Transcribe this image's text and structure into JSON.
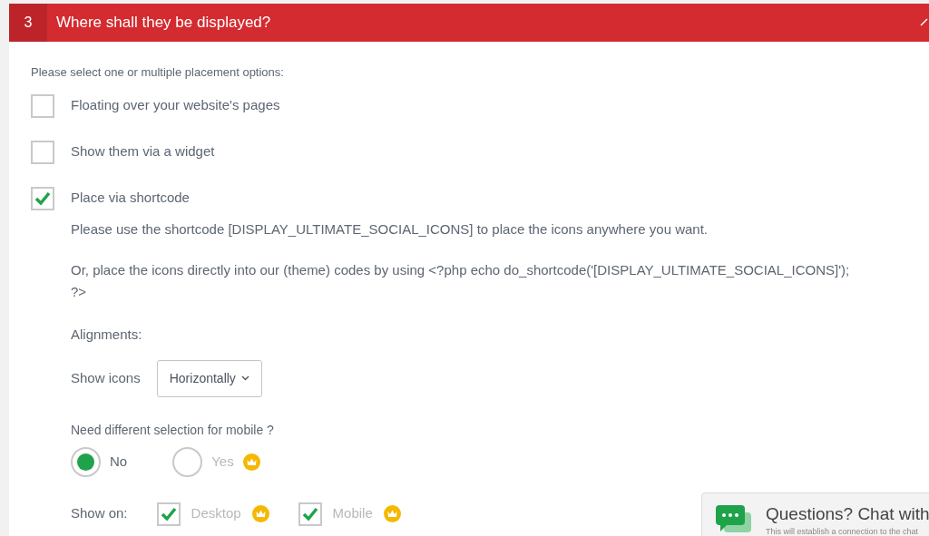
{
  "section": {
    "number": "3",
    "title": "Where shall they be displayed?",
    "expanded": true
  },
  "intro": "Please select one or multiple placement options:",
  "options": [
    {
      "label": "Floating over your website's pages",
      "checked": false
    },
    {
      "label": "Show them via a widget",
      "checked": false
    },
    {
      "label": "Place via shortcode",
      "checked": true
    }
  ],
  "shortcode_note": "Please use the shortcode [DISPLAY_ULTIMATE_SOCIAL_ICONS] to place the icons anywhere you want.",
  "php_note": "Or, place the icons directly into our (theme) codes by using <?php echo do_shortcode('[DISPLAY_ULTIMATE_SOCIAL_ICONS]'); ?>",
  "alignments_label": "Alignments:",
  "show_icons": {
    "label": "Show icons",
    "value": "Horizontally"
  },
  "mobile_question": "Need different selection for mobile ?",
  "mobile_choices": [
    {
      "label": "No",
      "selected": true,
      "premium": false
    },
    {
      "label": "Yes",
      "selected": false,
      "premium": true
    }
  ],
  "show_on": {
    "label": "Show on:",
    "items": [
      {
        "label": "Desktop",
        "checked": true,
        "premium": true
      },
      {
        "label": "Mobile",
        "checked": true,
        "premium": true
      }
    ]
  },
  "chat": {
    "title": "Questions? Chat with",
    "subtitle": "This will establish a connection to the chat"
  }
}
